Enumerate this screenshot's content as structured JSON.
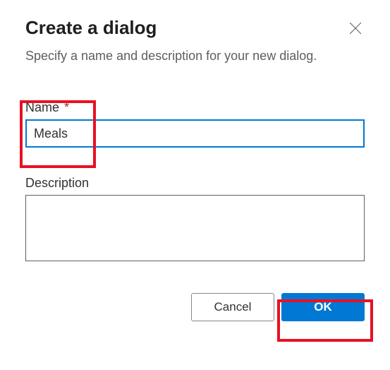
{
  "dialog": {
    "title": "Create a dialog",
    "subtitle": "Specify a name and description for your new dialog.",
    "close_aria": "Close"
  },
  "fields": {
    "name": {
      "label": "Name",
      "required_marker": "*",
      "value": "Meals"
    },
    "description": {
      "label": "Description",
      "value": ""
    }
  },
  "buttons": {
    "cancel": "Cancel",
    "ok": "OK"
  }
}
